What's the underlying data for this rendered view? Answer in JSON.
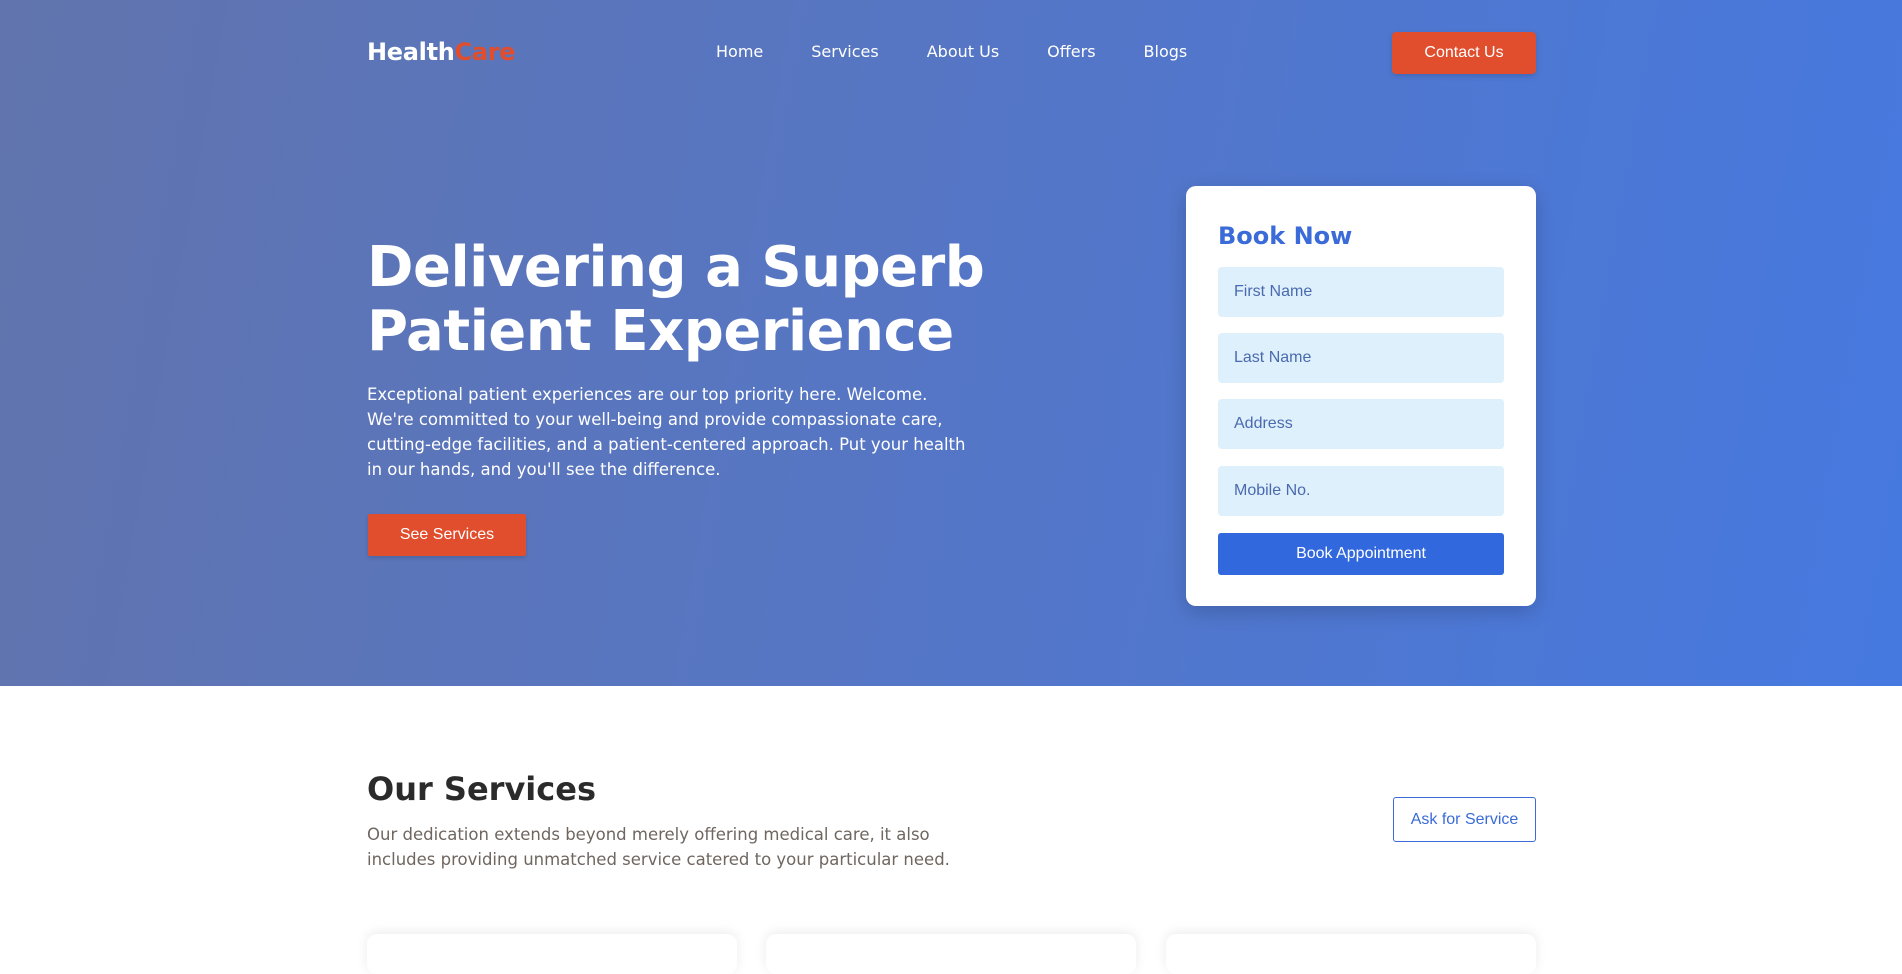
{
  "brand": {
    "part1": "Health",
    "part2": "Care",
    "accent_color": "#e04e2d"
  },
  "nav": {
    "items": [
      "Home",
      "Services",
      "About Us",
      "Offers",
      "Blogs"
    ]
  },
  "header": {
    "contact_label": "Contact Us"
  },
  "hero": {
    "title": "Delivering a Superb Patient Experience",
    "description": "Exceptional patient experiences are our top priority here. Welcome. We're committed to your well-being and provide compassionate care, cutting-edge facilities, and a patient-centered approach. Put your health in our hands, and you'll see the difference.",
    "cta_label": "See Services"
  },
  "booking": {
    "title": "Book Now",
    "fields": {
      "first_name": {
        "placeholder": "First Name",
        "value": ""
      },
      "last_name": {
        "placeholder": "Last Name",
        "value": ""
      },
      "address": {
        "placeholder": "Address",
        "value": ""
      },
      "mobile": {
        "placeholder": "Mobile No.",
        "value": ""
      }
    },
    "submit_label": "Book Appointment"
  },
  "services": {
    "title": "Our Services",
    "description": "Our dedication extends beyond merely offering medical care, it also includes providing unmatched service catered to your particular need.",
    "ask_label": "Ask for Service"
  },
  "colors": {
    "primary": "#3a6bd8",
    "accent": "#e04e2d",
    "field_bg": "#def0fb"
  }
}
